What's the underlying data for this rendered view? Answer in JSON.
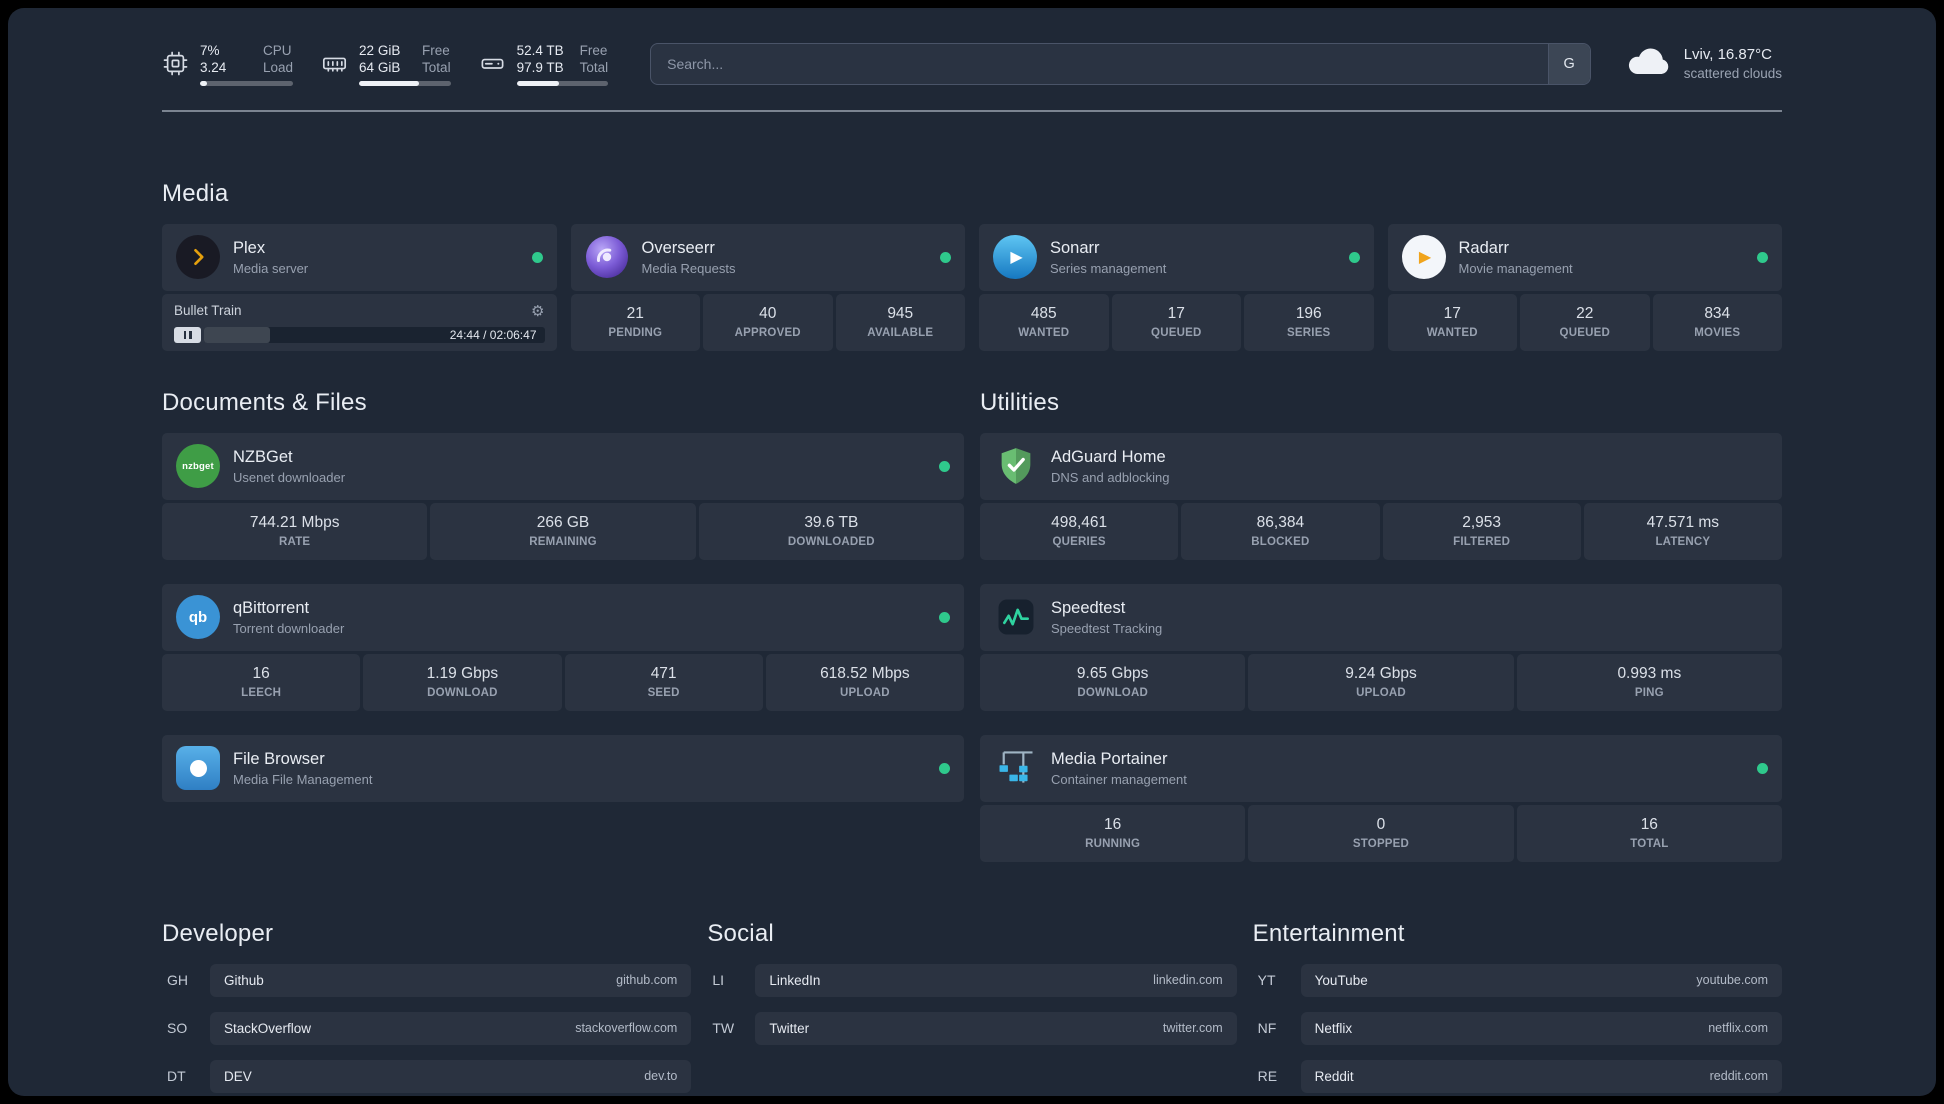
{
  "topbar": {
    "cpu": {
      "value1": "7%",
      "value2": "3.24",
      "label1": "CPU",
      "label2": "Load",
      "bar_style": "width:7%"
    },
    "memory": {
      "value1": "22 GiB",
      "value2": "64 GiB",
      "label1": "Free",
      "label2": "Total",
      "bar_style": "width:66%"
    },
    "disk": {
      "value1": "52.4 TB",
      "value2": "97.9 TB",
      "label1": "Free",
      "label2": "Total",
      "bar_style": "width:46%"
    },
    "search": {
      "placeholder": "Search...",
      "provider_label": "G"
    },
    "weather": {
      "location": "Lviv, 16.87°C",
      "condition": "scattered clouds"
    }
  },
  "sections": {
    "media": {
      "title": "Media",
      "services": [
        {
          "name": "Plex",
          "desc": "Media server",
          "online": true,
          "widget": {
            "title": "Bullet Train",
            "time": "24:44 / 02:06:47",
            "progress_style": "width:19.5%"
          }
        },
        {
          "name": "Overseerr",
          "desc": "Media Requests",
          "online": true,
          "stats": [
            {
              "v": "21",
              "l": "PENDING"
            },
            {
              "v": "40",
              "l": "APPROVED"
            },
            {
              "v": "945",
              "l": "AVAILABLE"
            }
          ]
        },
        {
          "name": "Sonarr",
          "desc": "Series management",
          "online": true,
          "stats": [
            {
              "v": "485",
              "l": "WANTED"
            },
            {
              "v": "17",
              "l": "QUEUED"
            },
            {
              "v": "196",
              "l": "SERIES"
            }
          ]
        },
        {
          "name": "Radarr",
          "desc": "Movie management",
          "online": true,
          "stats": [
            {
              "v": "17",
              "l": "WANTED"
            },
            {
              "v": "22",
              "l": "QUEUED"
            },
            {
              "v": "834",
              "l": "MOVIES"
            }
          ]
        }
      ]
    },
    "documents": {
      "title": "Documents & Files",
      "services": [
        {
          "name": "NZBGet",
          "desc": "Usenet downloader",
          "online": true,
          "stats": [
            {
              "v": "744.21 Mbps",
              "l": "RATE"
            },
            {
              "v": "266 GB",
              "l": "REMAINING"
            },
            {
              "v": "39.6 TB",
              "l": "DOWNLOADED"
            }
          ]
        },
        {
          "name": "qBittorrent",
          "desc": "Torrent downloader",
          "online": true,
          "stats": [
            {
              "v": "16",
              "l": "LEECH"
            },
            {
              "v": "1.19 Gbps",
              "l": "DOWNLOAD"
            },
            {
              "v": "471",
              "l": "SEED"
            },
            {
              "v": "618.52 Mbps",
              "l": "UPLOAD"
            }
          ]
        },
        {
          "name": "File Browser",
          "desc": "Media File Management",
          "online": true,
          "stats": []
        }
      ]
    },
    "utilities": {
      "title": "Utilities",
      "services": [
        {
          "name": "AdGuard Home",
          "desc": "DNS and adblocking",
          "online": false,
          "stats": [
            {
              "v": "498,461",
              "l": "QUERIES"
            },
            {
              "v": "86,384",
              "l": "BLOCKED"
            },
            {
              "v": "2,953",
              "l": "FILTERED"
            },
            {
              "v": "47.571 ms",
              "l": "LATENCY"
            }
          ]
        },
        {
          "name": "Speedtest",
          "desc": "Speedtest Tracking",
          "online": false,
          "stats": [
            {
              "v": "9.65 Gbps",
              "l": "DOWNLOAD"
            },
            {
              "v": "9.24 Gbps",
              "l": "UPLOAD"
            },
            {
              "v": "0.993 ms",
              "l": "PING"
            }
          ]
        },
        {
          "name": "Media Portainer",
          "desc": "Container management",
          "online": true,
          "stats": [
            {
              "v": "16",
              "l": "RUNNING"
            },
            {
              "v": "0",
              "l": "STOPPED"
            },
            {
              "v": "16",
              "l": "TOTAL"
            }
          ]
        }
      ]
    }
  },
  "bookmarks": {
    "developer": {
      "title": "Developer",
      "items": [
        {
          "abbr": "GH",
          "name": "Github",
          "url": "github.com"
        },
        {
          "abbr": "SO",
          "name": "StackOverflow",
          "url": "stackoverflow.com"
        },
        {
          "abbr": "DT",
          "name": "DEV",
          "url": "dev.to"
        }
      ]
    },
    "social": {
      "title": "Social",
      "items": [
        {
          "abbr": "LI",
          "name": "LinkedIn",
          "url": "linkedin.com"
        },
        {
          "abbr": "TW",
          "name": "Twitter",
          "url": "twitter.com"
        }
      ]
    },
    "entertainment": {
      "title": "Entertainment",
      "items": [
        {
          "abbr": "YT",
          "name": "YouTube",
          "url": "youtube.com"
        },
        {
          "abbr": "NF",
          "name": "Netflix",
          "url": "netflix.com"
        },
        {
          "abbr": "RE",
          "name": "Reddit",
          "url": "reddit.com"
        }
      ]
    }
  },
  "icons": {
    "nzbget_label": "nzbget",
    "qbittorrent_label": "qb",
    "gear_glyph": "⚙",
    "play_glyph": "▶"
  },
  "colors": {
    "status_online": "#2fc98c",
    "page_background": "#1f2836",
    "card_background": "#2b3444",
    "accent_plex": "#e5a00d"
  }
}
